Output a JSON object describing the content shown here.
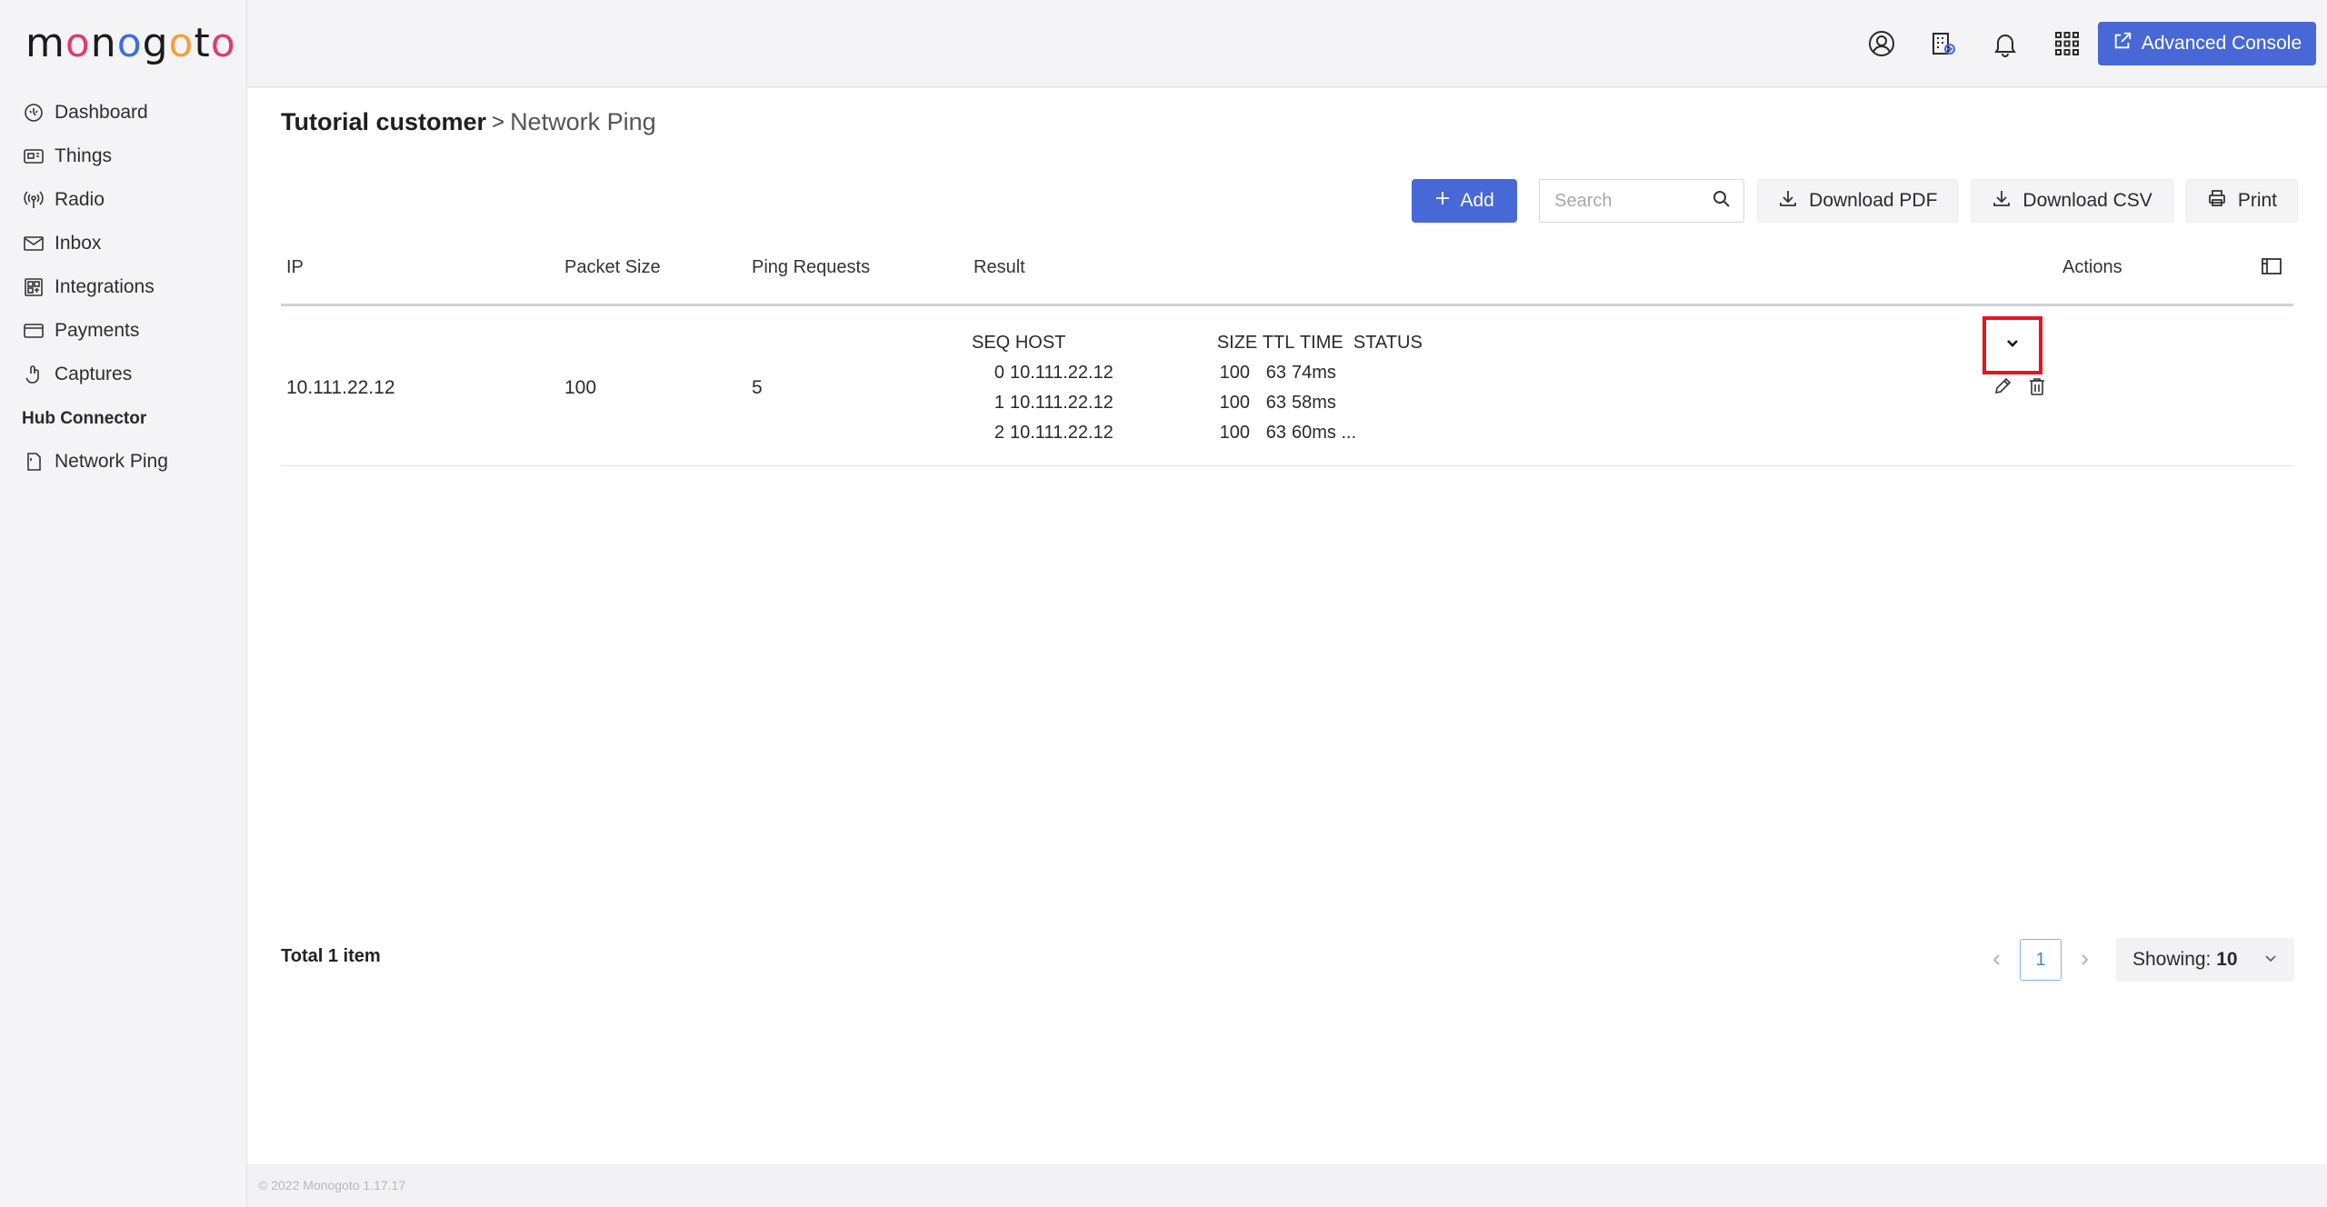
{
  "brand": {
    "logo_text": "monogoto"
  },
  "sidebar": {
    "items": [
      {
        "label": "Dashboard",
        "icon": "dashboard-icon"
      },
      {
        "label": "Things",
        "icon": "things-icon"
      },
      {
        "label": "Radio",
        "icon": "radio-icon"
      },
      {
        "label": "Inbox",
        "icon": "inbox-icon"
      },
      {
        "label": "Integrations",
        "icon": "integrations-icon"
      },
      {
        "label": "Payments",
        "icon": "payments-icon"
      },
      {
        "label": "Captures",
        "icon": "captures-icon"
      }
    ],
    "section_title": "Hub Connector",
    "section_items": [
      {
        "label": "Network Ping",
        "icon": "network-ping-icon"
      }
    ]
  },
  "topbar": {
    "icons": [
      "user-icon",
      "apps-building-icon",
      "bell-icon",
      "grid-icon"
    ],
    "advanced_console_label": "Advanced Console",
    "accent": "#4768d6"
  },
  "breadcrumb": {
    "root": "Tutorial customer",
    "separator": ">",
    "current": "Network Ping"
  },
  "toolbar": {
    "add_label": "Add",
    "search_placeholder": "Search",
    "download_pdf_label": "Download PDF",
    "download_csv_label": "Download CSV",
    "print_label": "Print"
  },
  "table": {
    "columns": [
      "IP",
      "Packet Size",
      "Ping Requests",
      "Result",
      "Actions"
    ],
    "rows": [
      {
        "ip": "10.111.22.12",
        "packet_size": "100",
        "ping_requests": "5",
        "result": {
          "header": {
            "seq": "SEQ",
            "host": "HOST",
            "size": "SIZE",
            "ttl": "TTL",
            "time": "TIME",
            "status": "STATUS"
          },
          "lines": [
            {
              "seq": "0",
              "host": "10.111.22.12",
              "size": "100",
              "ttl": "63",
              "time": "74ms"
            },
            {
              "seq": "1",
              "host": "10.111.22.12",
              "size": "100",
              "ttl": "63",
              "time": "58ms"
            },
            {
              "seq": "2",
              "host": "10.111.22.12",
              "size": "100",
              "ttl": "63",
              "time": "60ms ..."
            }
          ]
        }
      }
    ]
  },
  "footer": {
    "total_label": "Total 1 item",
    "current_page": "1",
    "showing_prefix": "Showing:",
    "showing_value": "10",
    "copyright": "© 2022 Monogoto 1.17.17"
  }
}
